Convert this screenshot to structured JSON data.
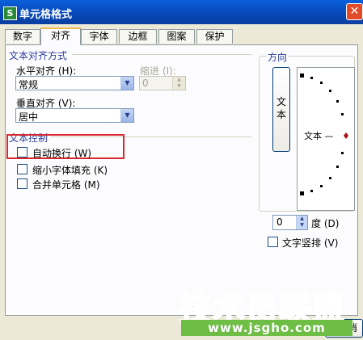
{
  "window": {
    "title": "单元格格式",
    "app_icon_letter": "S"
  },
  "tabs": [
    "数字",
    "对齐",
    "字体",
    "边框",
    "图案",
    "保护"
  ],
  "active_tab": "对齐",
  "text_alignment": {
    "group_title": "文本对齐方式",
    "horizontal_label": "水平对齐 (H):",
    "horizontal_value": "常规",
    "indent_label": "缩进 (I):",
    "indent_value": "0",
    "vertical_label": "垂直对齐 (V):",
    "vertical_value": "居中"
  },
  "text_control": {
    "group_title": "文本控制",
    "wrap_text": {
      "label": "自动换行 (W)",
      "checked": false
    },
    "shrink_to_fit": {
      "label": "缩小字体填充 (K)",
      "checked": false
    },
    "merge_cells": {
      "label": "合并单元格 (M)",
      "checked": false
    }
  },
  "orientation": {
    "group_title": "方向",
    "vertical_text_button": "文本",
    "dial_text": "文本 —",
    "degree_value": "0",
    "degree_label": "度 (D)",
    "vertical_text_checkbox": {
      "label": "文字竖排 (V)",
      "checked": false
    }
  },
  "watermark": {
    "brand": "技术员联盟",
    "url": "www.jsgho.com"
  },
  "buttons": {
    "cancel_partial": "消"
  },
  "colors": {
    "title_bar": "#0747b8",
    "group_title": "#2a3d9c",
    "highlight_box": "#d8282e",
    "watermark_green": "#2fb34a"
  }
}
